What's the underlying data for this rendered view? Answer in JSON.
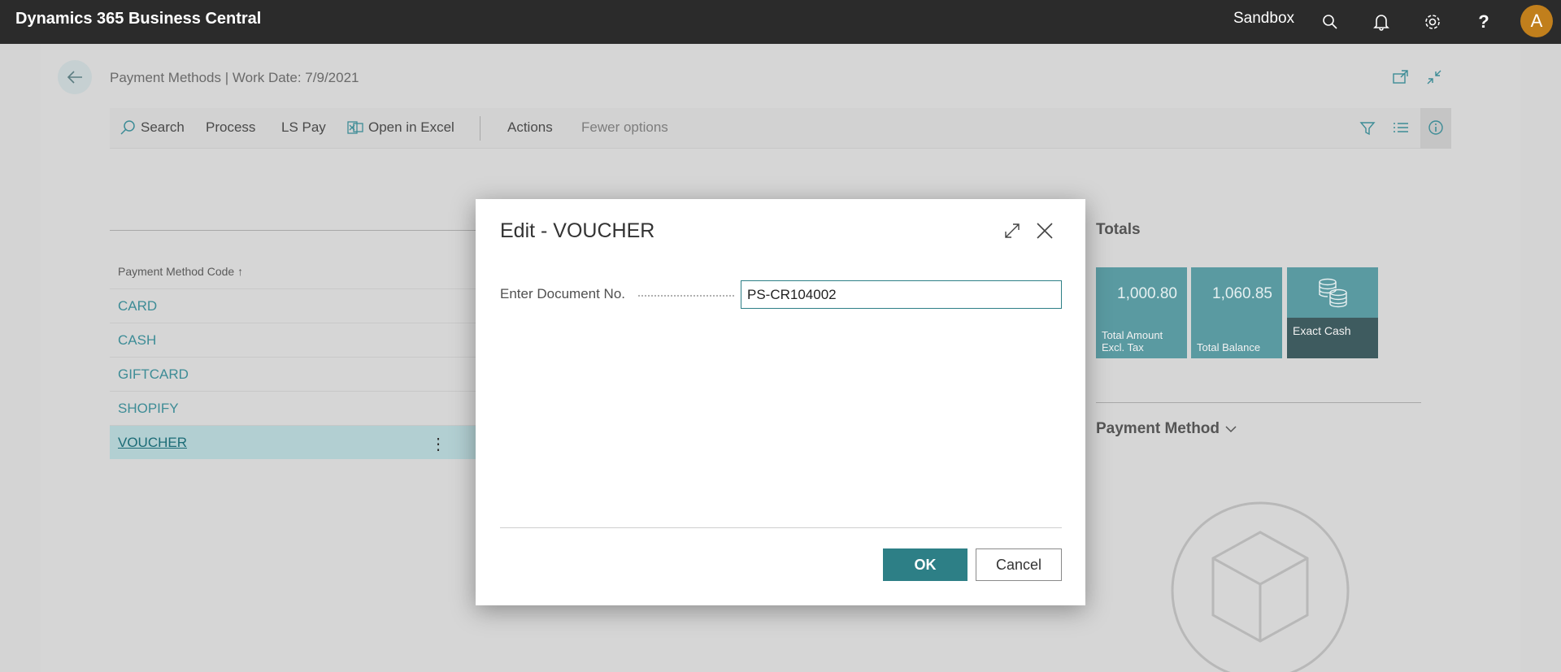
{
  "topbar": {
    "app_name": "Dynamics 365 Business Central",
    "environment": "Sandbox",
    "avatar_initial": "A",
    "avatar_color": "#c17f1c"
  },
  "page": {
    "title": "Payment Methods | Work Date: 7/9/2021"
  },
  "actionbar": {
    "search": "Search",
    "process": "Process",
    "ls_pay": "LS Pay",
    "open_in_excel": "Open in Excel",
    "actions": "Actions",
    "fewer_options": "Fewer options"
  },
  "list": {
    "column_header": "Payment Method Code ↑",
    "rows": [
      "CARD",
      "CASH",
      "GIFTCARD",
      "SHOPIFY",
      "VOUCHER"
    ],
    "selected": "VOUCHER",
    "row_menu": "⋮"
  },
  "factbox": {
    "totals_title": "Totals",
    "tiles": [
      {
        "value": "1,000.80",
        "label": "Total Amount Excl. Tax"
      },
      {
        "value": "1,060.85",
        "label": "Total Balance"
      },
      {
        "value": "",
        "label": "Exact Cash"
      }
    ],
    "payment_method_title": "Payment Method"
  },
  "dialog": {
    "title": "Edit - VOUCHER",
    "field_label": "Enter Document No.",
    "field_value": "PS-CR104002",
    "ok_label": "OK",
    "cancel_label": "Cancel"
  },
  "colors": {
    "accent": "#2d7f86",
    "link": "#3d8c96",
    "tile": "#5a9aa1",
    "topbar": "#2b2b2b"
  }
}
